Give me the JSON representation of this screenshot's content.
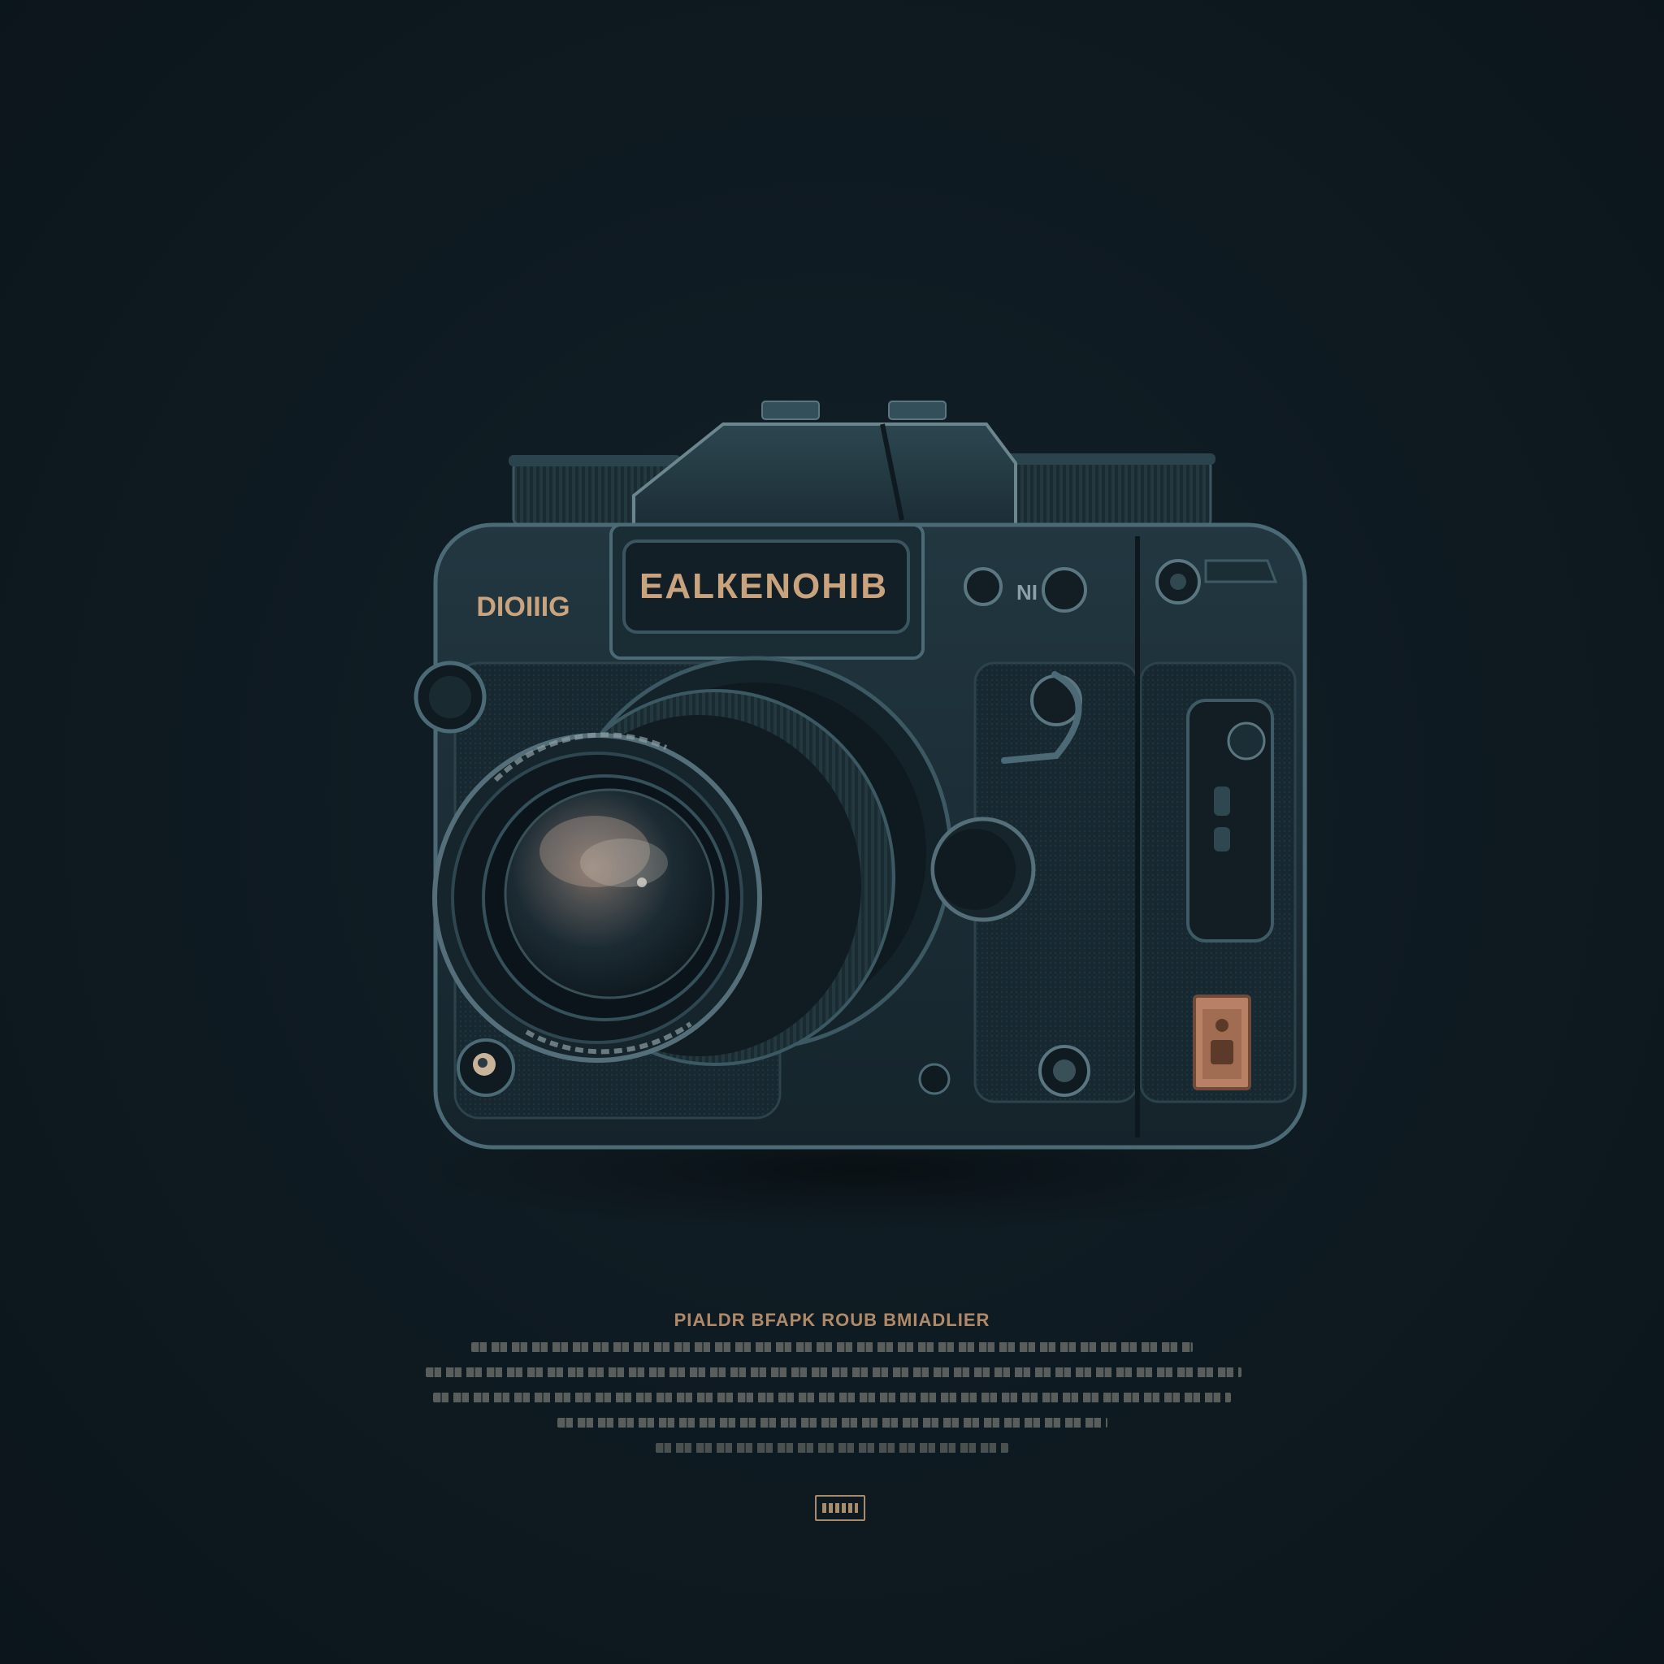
{
  "camera": {
    "top_plate_label": "ЕАLКЕNОНIВ",
    "side_label": "DIOIIIG",
    "dial_label": "NI"
  },
  "caption": {
    "title": "PIALDR BFAPK ROUB BMIADLIER"
  },
  "colors": {
    "background": "#0f1b22",
    "camera_body": "#1b2c34",
    "accent_gold": "#c9a27e",
    "lens_glass": "#1c2d36",
    "badge": "#a88a6c"
  }
}
